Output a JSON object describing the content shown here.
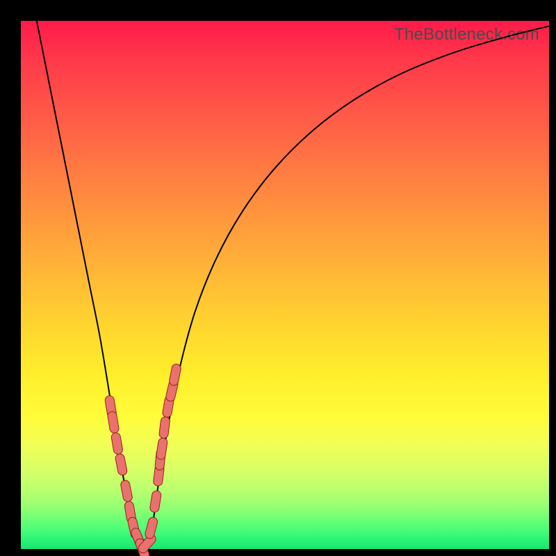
{
  "watermark": "TheBottleneck.com",
  "colors": {
    "marker_fill": "#e9716e",
    "marker_stroke": "#971f1f",
    "curve_stroke": "#000000",
    "frame_bg": "#000000"
  },
  "chart_data": {
    "type": "line",
    "title": "",
    "xlabel": "",
    "ylabel": "",
    "xlim": [
      0,
      100
    ],
    "ylim": [
      0,
      100
    ],
    "grid": false,
    "legend": false,
    "series": [
      {
        "name": "bottleneck-curve",
        "x": [
          3,
          5,
          7,
          9,
          11,
          13,
          15,
          17,
          18,
          19,
          20,
          21,
          22,
          23,
          24,
          25,
          26,
          28,
          30,
          33,
          37,
          42,
          48,
          55,
          63,
          72,
          82,
          92,
          100
        ],
        "y": [
          100,
          90,
          80,
          70,
          60,
          50,
          40,
          28,
          22,
          16,
          10,
          5,
          1,
          0,
          1,
          5,
          12,
          24,
          34,
          45,
          55,
          64,
          72,
          79,
          85,
          90,
          94,
          97,
          99
        ]
      }
    ],
    "markers": {
      "name": "highlighted-points",
      "x": [
        17.0,
        17.5,
        18.2,
        19.0,
        20.0,
        20.7,
        21.4,
        22.2,
        23.0,
        23.9,
        24.7,
        25.5,
        26.1,
        26.4,
        26.7,
        27.2,
        27.9,
        28.6,
        29.2
      ],
      "y": [
        27,
        24,
        20,
        16,
        11,
        7,
        4,
        2,
        0,
        1,
        4,
        9,
        14,
        17,
        19,
        23,
        27,
        30,
        33
      ]
    }
  }
}
